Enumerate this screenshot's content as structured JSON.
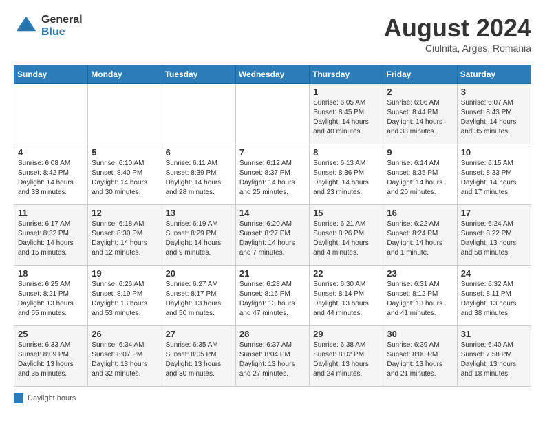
{
  "header": {
    "logo_general": "General",
    "logo_blue": "Blue",
    "month_year": "August 2024",
    "location": "Ciulnita, Arges, Romania"
  },
  "legend": {
    "label": "Daylight hours"
  },
  "days_of_week": [
    "Sunday",
    "Monday",
    "Tuesday",
    "Wednesday",
    "Thursday",
    "Friday",
    "Saturday"
  ],
  "weeks": [
    [
      {
        "day": "",
        "info": ""
      },
      {
        "day": "",
        "info": ""
      },
      {
        "day": "",
        "info": ""
      },
      {
        "day": "",
        "info": ""
      },
      {
        "day": "1",
        "info": "Sunrise: 6:05 AM\nSunset: 8:45 PM\nDaylight: 14 hours\nand 40 minutes."
      },
      {
        "day": "2",
        "info": "Sunrise: 6:06 AM\nSunset: 8:44 PM\nDaylight: 14 hours\nand 38 minutes."
      },
      {
        "day": "3",
        "info": "Sunrise: 6:07 AM\nSunset: 8:43 PM\nDaylight: 14 hours\nand 35 minutes."
      }
    ],
    [
      {
        "day": "4",
        "info": "Sunrise: 6:08 AM\nSunset: 8:42 PM\nDaylight: 14 hours\nand 33 minutes."
      },
      {
        "day": "5",
        "info": "Sunrise: 6:10 AM\nSunset: 8:40 PM\nDaylight: 14 hours\nand 30 minutes."
      },
      {
        "day": "6",
        "info": "Sunrise: 6:11 AM\nSunset: 8:39 PM\nDaylight: 14 hours\nand 28 minutes."
      },
      {
        "day": "7",
        "info": "Sunrise: 6:12 AM\nSunset: 8:37 PM\nDaylight: 14 hours\nand 25 minutes."
      },
      {
        "day": "8",
        "info": "Sunrise: 6:13 AM\nSunset: 8:36 PM\nDaylight: 14 hours\nand 23 minutes."
      },
      {
        "day": "9",
        "info": "Sunrise: 6:14 AM\nSunset: 8:35 PM\nDaylight: 14 hours\nand 20 minutes."
      },
      {
        "day": "10",
        "info": "Sunrise: 6:15 AM\nSunset: 8:33 PM\nDaylight: 14 hours\nand 17 minutes."
      }
    ],
    [
      {
        "day": "11",
        "info": "Sunrise: 6:17 AM\nSunset: 8:32 PM\nDaylight: 14 hours\nand 15 minutes."
      },
      {
        "day": "12",
        "info": "Sunrise: 6:18 AM\nSunset: 8:30 PM\nDaylight: 14 hours\nand 12 minutes."
      },
      {
        "day": "13",
        "info": "Sunrise: 6:19 AM\nSunset: 8:29 PM\nDaylight: 14 hours\nand 9 minutes."
      },
      {
        "day": "14",
        "info": "Sunrise: 6:20 AM\nSunset: 8:27 PM\nDaylight: 14 hours\nand 7 minutes."
      },
      {
        "day": "15",
        "info": "Sunrise: 6:21 AM\nSunset: 8:26 PM\nDaylight: 14 hours\nand 4 minutes."
      },
      {
        "day": "16",
        "info": "Sunrise: 6:22 AM\nSunset: 8:24 PM\nDaylight: 14 hours\nand 1 minute."
      },
      {
        "day": "17",
        "info": "Sunrise: 6:24 AM\nSunset: 8:22 PM\nDaylight: 13 hours\nand 58 minutes."
      }
    ],
    [
      {
        "day": "18",
        "info": "Sunrise: 6:25 AM\nSunset: 8:21 PM\nDaylight: 13 hours\nand 55 minutes."
      },
      {
        "day": "19",
        "info": "Sunrise: 6:26 AM\nSunset: 8:19 PM\nDaylight: 13 hours\nand 53 minutes."
      },
      {
        "day": "20",
        "info": "Sunrise: 6:27 AM\nSunset: 8:17 PM\nDaylight: 13 hours\nand 50 minutes."
      },
      {
        "day": "21",
        "info": "Sunrise: 6:28 AM\nSunset: 8:16 PM\nDaylight: 13 hours\nand 47 minutes."
      },
      {
        "day": "22",
        "info": "Sunrise: 6:30 AM\nSunset: 8:14 PM\nDaylight: 13 hours\nand 44 minutes."
      },
      {
        "day": "23",
        "info": "Sunrise: 6:31 AM\nSunset: 8:12 PM\nDaylight: 13 hours\nand 41 minutes."
      },
      {
        "day": "24",
        "info": "Sunrise: 6:32 AM\nSunset: 8:11 PM\nDaylight: 13 hours\nand 38 minutes."
      }
    ],
    [
      {
        "day": "25",
        "info": "Sunrise: 6:33 AM\nSunset: 8:09 PM\nDaylight: 13 hours\nand 35 minutes."
      },
      {
        "day": "26",
        "info": "Sunrise: 6:34 AM\nSunset: 8:07 PM\nDaylight: 13 hours\nand 32 minutes."
      },
      {
        "day": "27",
        "info": "Sunrise: 6:35 AM\nSunset: 8:05 PM\nDaylight: 13 hours\nand 30 minutes."
      },
      {
        "day": "28",
        "info": "Sunrise: 6:37 AM\nSunset: 8:04 PM\nDaylight: 13 hours\nand 27 minutes."
      },
      {
        "day": "29",
        "info": "Sunrise: 6:38 AM\nSunset: 8:02 PM\nDaylight: 13 hours\nand 24 minutes."
      },
      {
        "day": "30",
        "info": "Sunrise: 6:39 AM\nSunset: 8:00 PM\nDaylight: 13 hours\nand 21 minutes."
      },
      {
        "day": "31",
        "info": "Sunrise: 6:40 AM\nSunset: 7:58 PM\nDaylight: 13 hours\nand 18 minutes."
      }
    ]
  ]
}
